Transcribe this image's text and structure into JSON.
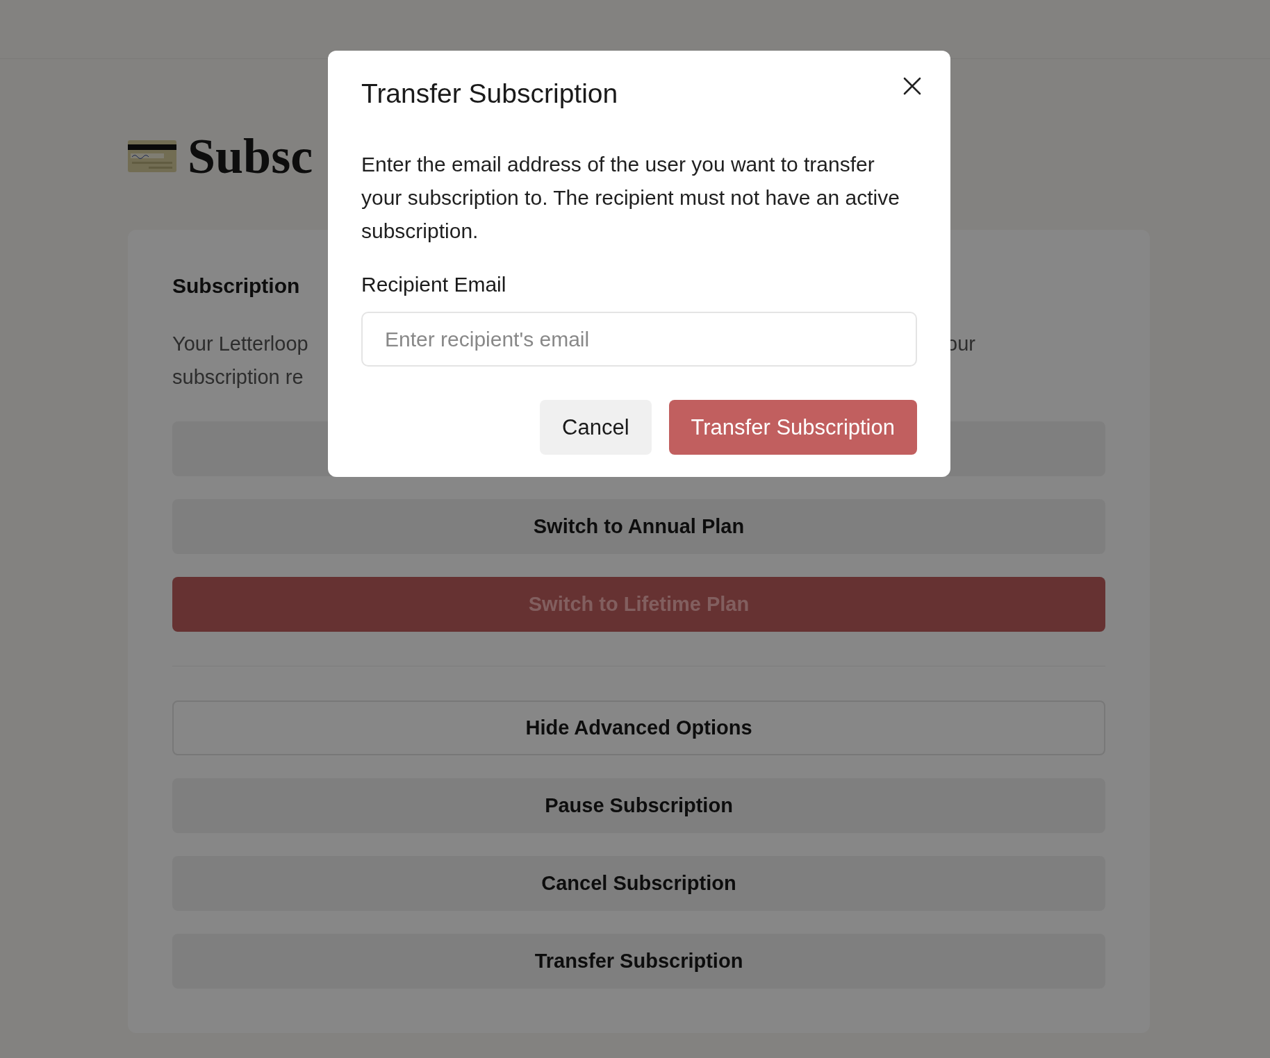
{
  "page": {
    "title": "Subsc"
  },
  "card": {
    "heading": "Subscription",
    "description": {
      "left_lines": [
        "Your Letterloop",
        "subscription re"
      ],
      "right_lines": [
        "our"
      ]
    },
    "plan_buttons": [
      {
        "kind": "secondary"
      },
      {
        "label": "Switch to Annual Plan",
        "kind": "secondary"
      },
      {
        "label": "Switch to Lifetime Plan",
        "kind": "primary"
      }
    ],
    "advanced_buttons": [
      {
        "label": "Hide Advanced Options",
        "kind": "outline"
      },
      {
        "label": "Pause Subscription",
        "kind": "secondary"
      },
      {
        "label": "Cancel Subscription",
        "kind": "secondary"
      },
      {
        "label": "Transfer Subscription",
        "kind": "secondary"
      }
    ]
  },
  "modal": {
    "title": "Transfer Subscription",
    "body": "Enter the email address of the user you want to transfer your subscription to. The recipient must not have an active subscription.",
    "field_label": "Recipient Email",
    "placeholder": "Enter recipient's email",
    "buttons": [
      {
        "label": "Cancel",
        "kind": "secondary"
      },
      {
        "label": "Transfer Subscription",
        "kind": "primary"
      }
    ]
  }
}
